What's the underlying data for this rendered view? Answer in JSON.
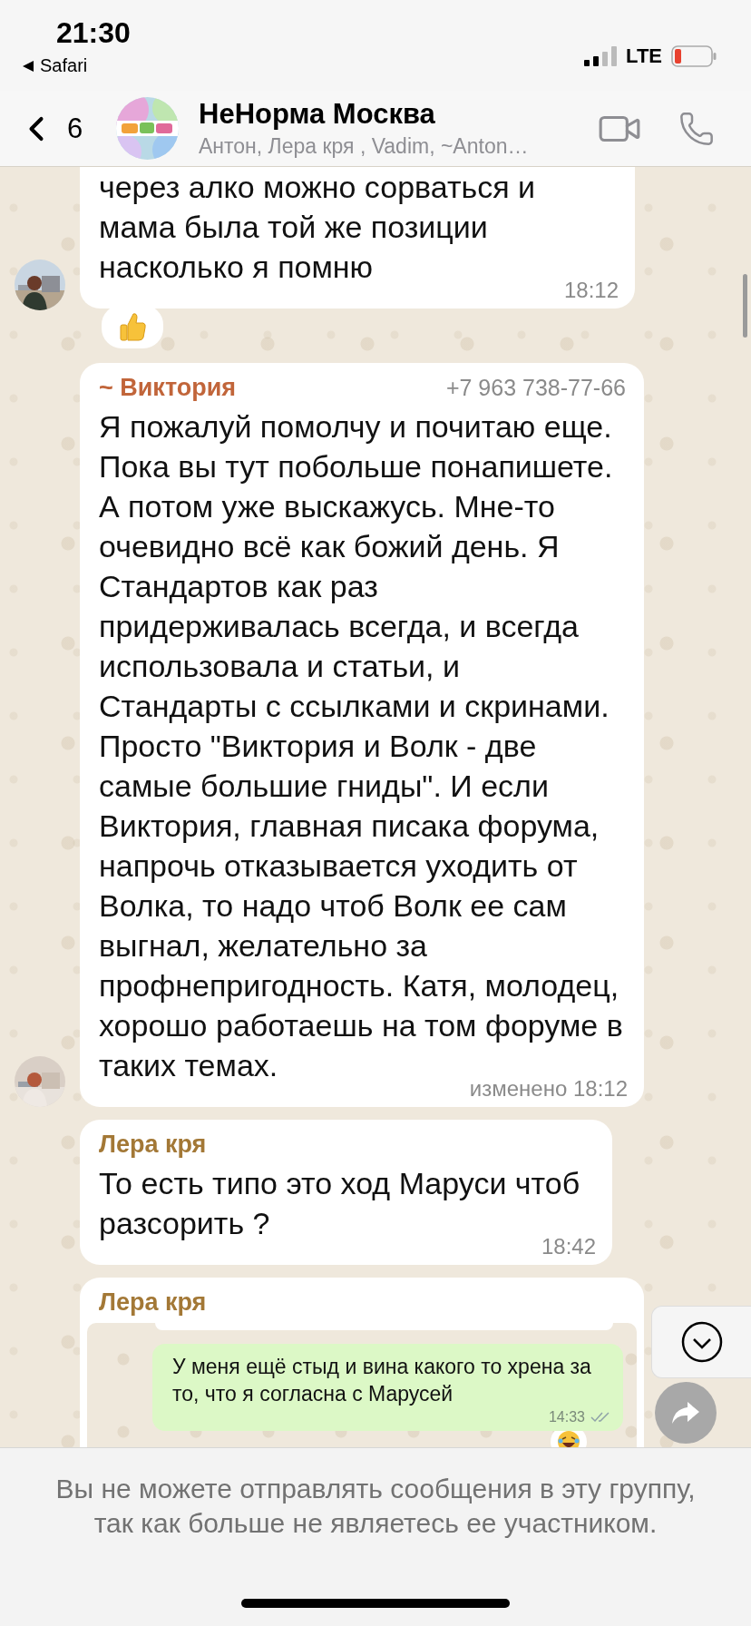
{
  "status_bar": {
    "time": "21:30",
    "back_app": "Safari",
    "network": "LTE"
  },
  "header": {
    "back_count": "6",
    "title": "НеНорма Москва",
    "members": "Антон, Лера кря , Vadim, ~Anton…"
  },
  "messages": [
    {
      "kind": "text",
      "text": "через алко можно сорваться и мама была той же позиции насколько я помню",
      "time": "18:12",
      "avatar": true,
      "reaction": true
    },
    {
      "kind": "text",
      "sender": "~ Виктория",
      "color": "#c1653a",
      "phone": "+7 963 738-77-66",
      "text": "Я пожалуй помолчу и почитаю еще. Пока вы тут побольше понапишете. А потом уже выскажусь. Мне-то очевидно всё как божий день. Я Стандартов как раз придерживалась всегда, и всегда использовала и статьи, и Стандарты с ссылками и скринами. Просто \"Виктория и Волк - две самые большие гниды\". И если Виктория, главная писака форума, напрочь отказывается уходить от Волка, то надо чтоб Волк ее сам выгнал, желательно за профнепригодность. Катя, молодец, хорошо работаешь на том форуме в таких темах.",
      "time": "изменено 18:12",
      "avatar": true,
      "reaction": false
    },
    {
      "kind": "text",
      "sender": "Лера кря",
      "color": "#a37836",
      "text": "То есть типо это ход Маруси чтоб разсорить ?",
      "time": "18:42",
      "avatar": false,
      "reaction": false
    },
    {
      "kind": "screenshot",
      "sender": "Лера кря",
      "color": "#a37836",
      "inner": {
        "text": "У меня ещё стыд и вина какого то хрена за то, что я согласна с Марусей",
        "time": "14:33",
        "read": true,
        "reaction": true
      }
    }
  ],
  "footer": {
    "notice": "Вы не можете отправлять сообщения в эту группу, так как больше не являетесь ее участником."
  }
}
